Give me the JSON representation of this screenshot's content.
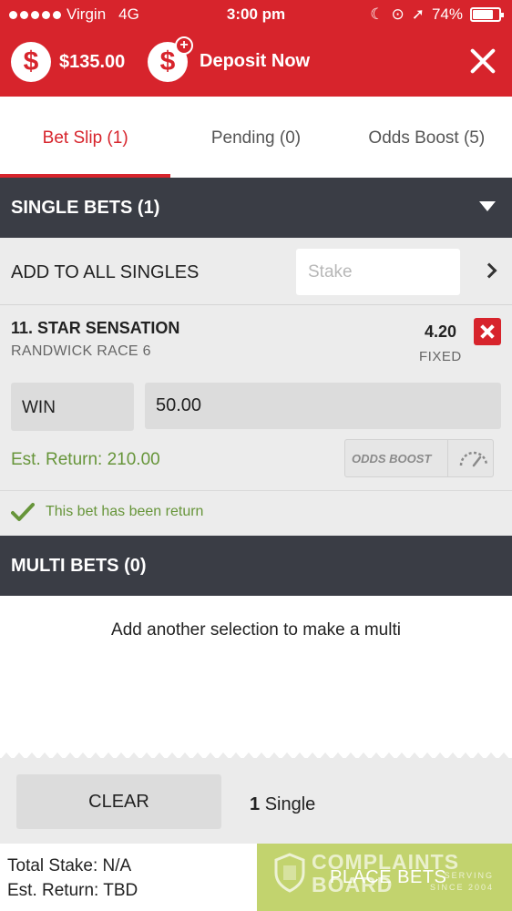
{
  "status_bar": {
    "carrier": "Virgin",
    "network": "4G",
    "time": "3:00 pm",
    "battery": "74%",
    "battery_level": 0.74
  },
  "header": {
    "balance": "$135.00",
    "deposit_label": "Deposit Now",
    "coin_symbol": "$",
    "accent_color": "#d7242c"
  },
  "tabs": [
    {
      "label": "Bet Slip (1)",
      "active": true
    },
    {
      "label": "Pending (0)",
      "active": false
    },
    {
      "label": "Odds Boost (5)",
      "active": false
    }
  ],
  "single_bets": {
    "title": "SINGLE BETS (1)",
    "add_all_label": "ADD TO ALL SINGLES",
    "stake_placeholder": "Stake",
    "bet": {
      "runner": "11. STAR SENSATION",
      "race": "RANDWICK RACE 6",
      "odds": "4.20",
      "odds_type": "FIXED",
      "bet_type": "WIN",
      "stake": "50.00",
      "est_return": "Est. Return: 210.00",
      "odds_boost_label": "ODDS BOOST",
      "confirmation": "This bet has been return"
    }
  },
  "multi_bets": {
    "title": "MULTI BETS (0)",
    "message": "Add another selection to make a multi"
  },
  "footer": {
    "clear_label": "CLEAR",
    "single_count": "1",
    "single_label": "Single",
    "total_stake": "Total Stake: N/A",
    "est_return": "Est. Return: TBD",
    "place_label": "PLACE BETS"
  },
  "watermark": {
    "line1": "COMPLAINTS",
    "line2": "BOARD",
    "tag1": "SERVING",
    "tag2": "SINCE 2004"
  }
}
